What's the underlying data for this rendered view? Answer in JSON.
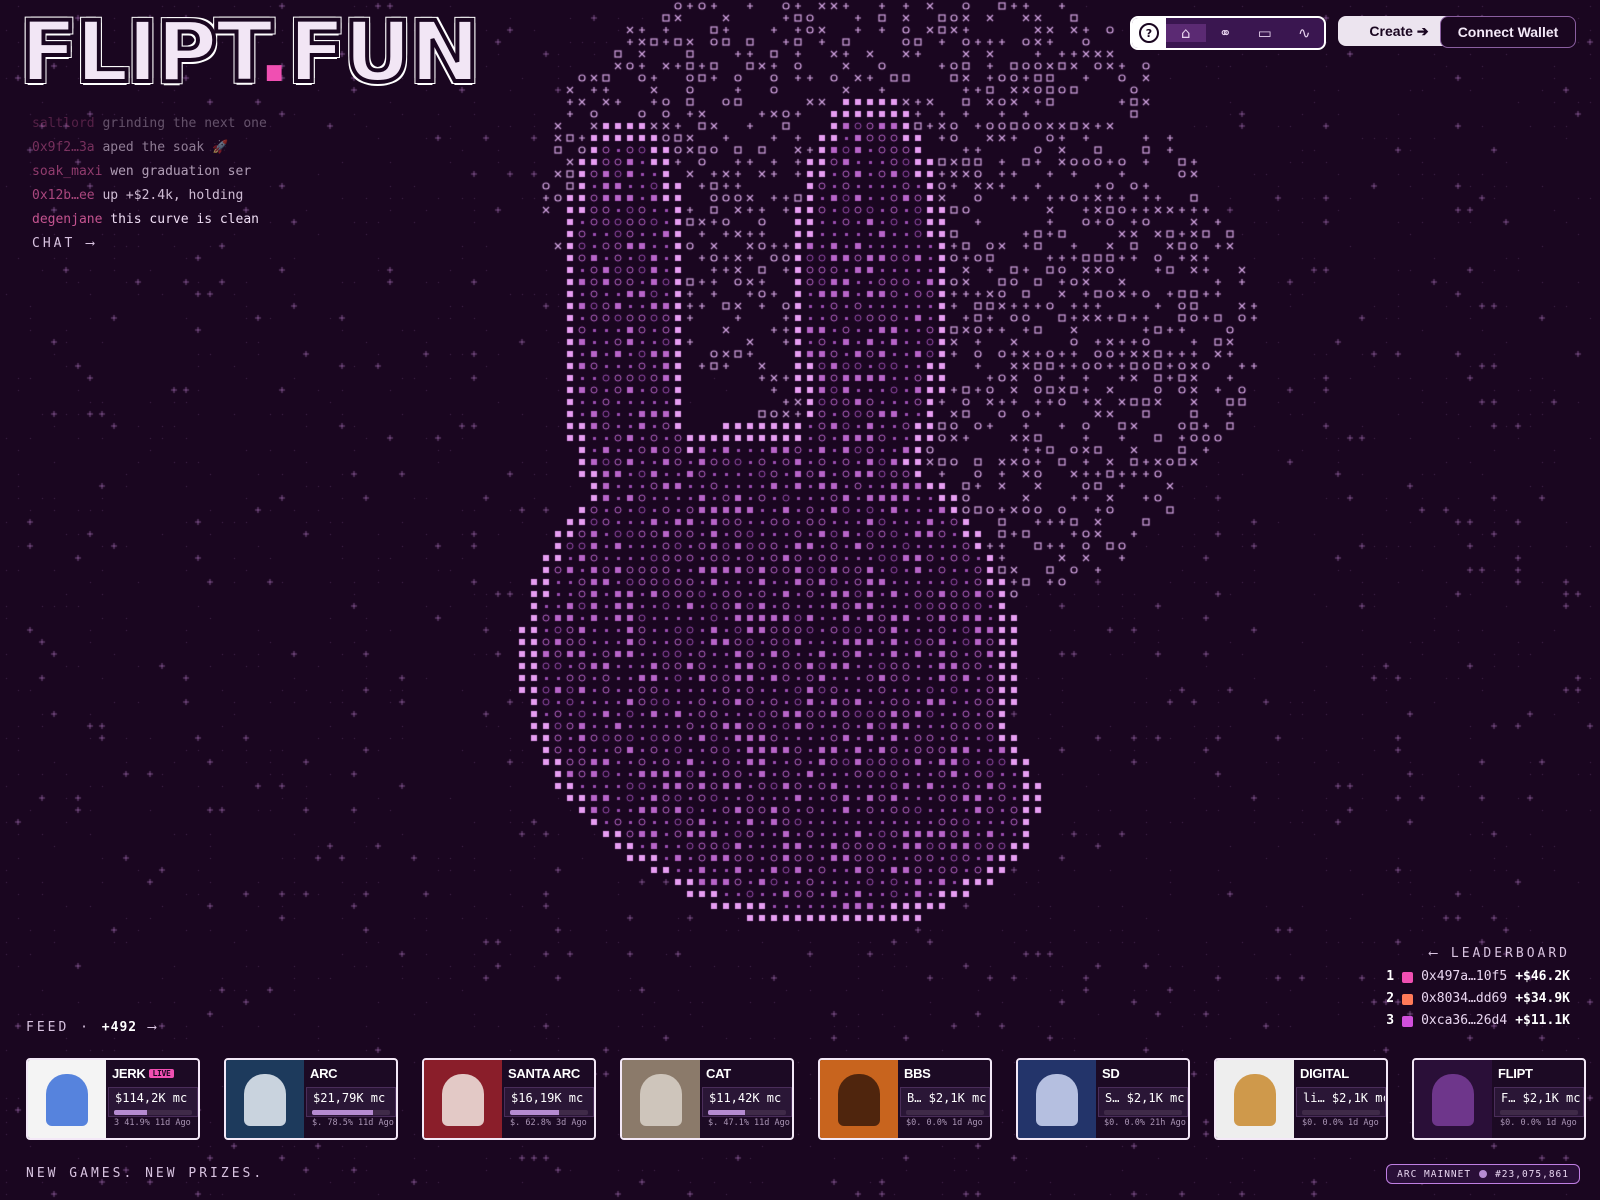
{
  "brand": {
    "logo_text": "FLIPT",
    "logo_dot": ".",
    "logo_tld": "FUN"
  },
  "chat": {
    "messages": [
      {
        "user": "saltlord",
        "text": "grinding the next one"
      },
      {
        "user": "0x9f2…3a",
        "text": "aped the soak 🚀"
      },
      {
        "user": "soak_maxi",
        "text": "wen graduation ser"
      },
      {
        "user": "0x12b…ee",
        "text": "up +$2.4k, holding"
      },
      {
        "user": "degenjane",
        "text": "this curve is clean"
      }
    ],
    "link_label": "CHAT ⟶"
  },
  "nav": {
    "help_icon": "?",
    "icons": [
      "home-icon",
      "link-icon",
      "wallet-icon",
      "activity-icon"
    ],
    "create_label": "Create ➔",
    "wallet_label": "Connect Wallet"
  },
  "leaderboard": {
    "title": "⟵ LEADERBOARD",
    "rows": [
      {
        "rank": "1",
        "address": "0x497a…10f5",
        "pnl": "+$46.2K",
        "avatar_color": "#f04fb2"
      },
      {
        "rank": "2",
        "address": "0x8034…dd69",
        "pnl": "+$34.9K",
        "avatar_color": "#ff7a59"
      },
      {
        "rank": "3",
        "address": "0xca36…26d4",
        "pnl": "+$11.1K",
        "avatar_color": "#d14fdc"
      }
    ]
  },
  "feed": {
    "title": "FEED · ",
    "count": "+492",
    "arrow": "⟶",
    "cards": [
      {
        "name": "JERK",
        "live": "LIVE",
        "mc": "$114,2K mc",
        "progress": 41.9,
        "meta": "3 41.9% 11d Ago",
        "thumb_bg": "#f4f4f4",
        "thumb_fg": "#3a6fd8"
      },
      {
        "name": "ARC",
        "live": "",
        "mc": "$21,79K mc",
        "progress": 78.5,
        "meta": "$. 78.5% 11d Ago",
        "thumb_bg": "#1d3a5c",
        "thumb_fg": "#e8eef5"
      },
      {
        "name": "SANTA ARC",
        "live": "",
        "mc": "$16,19K mc",
        "progress": 62.8,
        "meta": "$. 62.8% 3d Ago",
        "thumb_bg": "#8a1e2a",
        "thumb_fg": "#f2e8e2"
      },
      {
        "name": "CAT",
        "live": "",
        "mc": "$11,42K mc",
        "progress": 47.1,
        "meta": "$. 47.1% 11d Ago",
        "thumb_bg": "#8b7a6a",
        "thumb_fg": "#d9d2c9"
      },
      {
        "name": "BBS",
        "live": "",
        "mc": "B… $2,1K mc",
        "progress": 0.0,
        "meta": "$0. 0.0% 1d Ago",
        "thumb_bg": "#c8641e",
        "thumb_fg": "#3a1a0a"
      },
      {
        "name": "SD",
        "live": "",
        "mc": "S… $2,1K mc",
        "progress": 0.0,
        "meta": "$0. 0.0% 21h Ago",
        "thumb_bg": "#23346a",
        "thumb_fg": "#cfd8f5"
      },
      {
        "name": "DIGITAL",
        "live": "",
        "mc": "li… $2,1K mc",
        "progress": 0.0,
        "meta": "$0. 0.0% 1d Ago",
        "thumb_bg": "#eeeeee",
        "thumb_fg": "#c98a2e"
      },
      {
        "name": "FLIPT",
        "live": "",
        "mc": "F… $2,1K mc",
        "progress": 0.0,
        "meta": "$0. 0.0% 1d Ago",
        "thumb_bg": "#2a0f38",
        "thumb_fg": "#7a3d9a"
      }
    ]
  },
  "footer": {
    "tagline": "NEW GAMES. NEW PRIZES.",
    "network": "ARC MAINNET",
    "block": "#23,075,861"
  },
  "colors": {
    "background": "#1a0620",
    "accent": "#f04fb2",
    "art": "#d98be8"
  }
}
